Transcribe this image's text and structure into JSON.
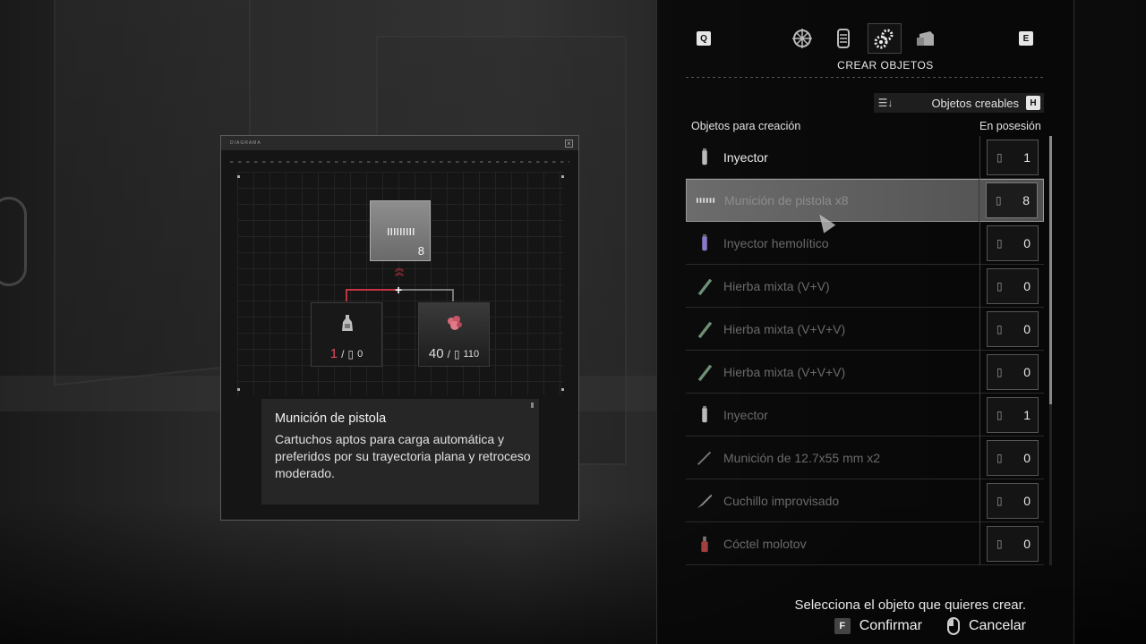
{
  "menu": {
    "prev_key": "Q",
    "next_key": "E",
    "tabs": [
      {
        "icon": "map-icon"
      },
      {
        "icon": "files-icon"
      },
      {
        "icon": "craft-gears-icon",
        "active": true
      },
      {
        "icon": "inventory-icon"
      }
    ],
    "active_tab_label": "CREAR OBJETOS"
  },
  "sort": {
    "label": "Objetos creables",
    "key": "H"
  },
  "list": {
    "header_left": "Objetos para creación",
    "header_right": "En posesión",
    "items": [
      {
        "name": "Inyector",
        "count": "1",
        "state": "available",
        "icon": "injector-icon"
      },
      {
        "name": "Munición de pistola x8",
        "count": "8",
        "state": "selected",
        "icon": "handgun-ammo-icon"
      },
      {
        "name": "Inyector hemolítico",
        "count": "0",
        "state": "unavailable",
        "icon": "hemolytic-injector-icon"
      },
      {
        "name": "Hierba mixta (V+V)",
        "count": "0",
        "state": "unavailable",
        "icon": "herb-icon"
      },
      {
        "name": "Hierba mixta (V+V+V)",
        "count": "0",
        "state": "unavailable",
        "icon": "herb-icon"
      },
      {
        "name": "Hierba mixta (V+V+V)",
        "count": "0",
        "state": "unavailable",
        "icon": "herb-icon"
      },
      {
        "name": "Inyector",
        "count": "1",
        "state": "unavailable",
        "icon": "injector-icon"
      },
      {
        "name": "Munición de 12.7x55 mm x2",
        "count": "0",
        "state": "unavailable",
        "icon": "rifle-ammo-icon"
      },
      {
        "name": "Cuchillo improvisado",
        "count": "0",
        "state": "unavailable",
        "icon": "knife-icon"
      },
      {
        "name": "Cóctel molotov",
        "count": "0",
        "state": "unavailable",
        "icon": "molotov-icon"
      }
    ]
  },
  "footer": {
    "hint": "Selecciona el objeto que quieres crear.",
    "confirm_key": "F",
    "confirm_label": "Confirmar",
    "cancel_label": "Cancelar"
  },
  "diagram": {
    "title": "DIAGRAMA",
    "result": {
      "quantity": "8",
      "icon": "handgun-ammo-icon"
    },
    "ingredients": [
      {
        "icon": "gunpowder-icon",
        "required": "1",
        "owned": "0",
        "short": true
      },
      {
        "icon": "resource-flakes-icon",
        "required": "40",
        "owned": "110",
        "short": false
      }
    ],
    "description": {
      "title": "Munición de pistola",
      "text": "Cartuchos aptos para carga automática y preferidos por su trayectoria plana y retroceso moderado."
    }
  },
  "colors": {
    "accent_red": "#c23444",
    "shortage_red": "#e04b5a",
    "selected_row": "#6c6c6c"
  }
}
